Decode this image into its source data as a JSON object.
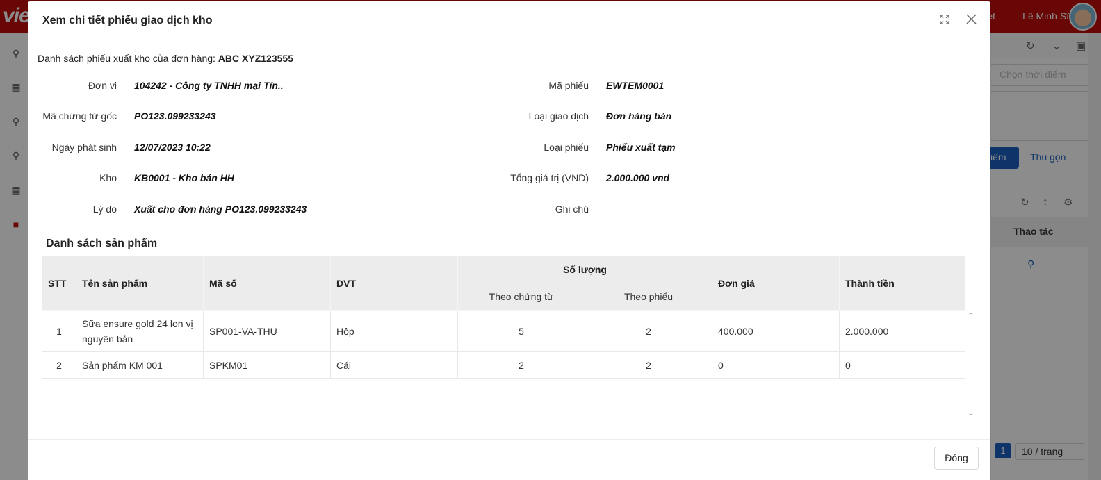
{
  "background": {
    "logo": "vie",
    "user_fragment": "et",
    "user_name": "Lê Minh Sĩ",
    "time_placeholder": "Chọn thời điểm",
    "search_button": "kiếm",
    "collapse_link": "Thu gọn",
    "table_header_action": "Thao tác",
    "page_current": "1",
    "page_size": "10 / trang"
  },
  "modal": {
    "title": "Xem chi tiết phiếu giao dịch kho",
    "info_prefix": "Danh sách phiếu xuất kho của đơn hàng: ",
    "order_code": "ABC XYZ123555",
    "fields": {
      "don_vi": {
        "label": "Đơn vị",
        "value": "104242 - Công ty TNHH mại Tín.."
      },
      "ma_chung_tu": {
        "label": "Mã chứng từ gốc",
        "value": "PO123.099233243"
      },
      "ngay_phat_sinh": {
        "label": "Ngày phát sinh",
        "value": "12/07/2023 10:22"
      },
      "kho": {
        "label": "Kho",
        "value": "KB0001 - Kho bán HH"
      },
      "ly_do": {
        "label": "Lý do",
        "value": "Xuất cho đơn hàng PO123.099233243"
      },
      "ma_phieu": {
        "label": "Mã phiếu",
        "value": "EWTEM0001"
      },
      "loai_giao_dich": {
        "label": "Loại giao dịch",
        "value": "Đơn hàng bán"
      },
      "loai_phieu": {
        "label": "Loại phiếu",
        "value": "Phiếu xuất tạm"
      },
      "tong_gia_tri": {
        "label": "Tổng giá trị (VND)",
        "value": "2.000.000 vnd"
      },
      "ghi_chu": {
        "label": "Ghi chú",
        "value": ""
      }
    },
    "section_title": "Danh sách sản phẩm",
    "table": {
      "headers": {
        "stt": "STT",
        "ten": "Tên sản phẩm",
        "ma": "Mã số",
        "dvt": "DVT",
        "so_luong": "Số lượng",
        "theo_chung_tu": "Theo chứng từ",
        "theo_phieu": "Theo phiếu",
        "don_gia": "Đơn giá",
        "thanh_tien": "Thành tiền"
      },
      "rows": [
        {
          "stt": "1",
          "ten": "Sữa ensure gold 24 lon vị nguyên bản",
          "ma": "SP001-VA-THU",
          "dvt": "Hộp",
          "theo_chung_tu": "5",
          "theo_phieu": "2",
          "don_gia": "400.000",
          "thanh_tien": "2.000.000"
        },
        {
          "stt": "2",
          "ten": "Sản phẩm KM 001",
          "ma": "SPKM01",
          "dvt": "Cái",
          "theo_chung_tu": "2",
          "theo_phieu": "2",
          "don_gia": "0",
          "thanh_tien": "0"
        }
      ]
    },
    "close_button": "Đóng"
  }
}
